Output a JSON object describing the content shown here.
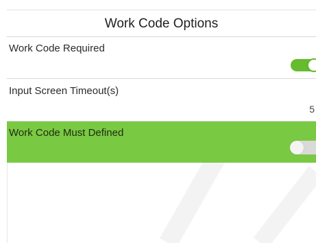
{
  "header": {
    "title": "Work Code Options"
  },
  "settings": [
    {
      "label": "Work Code Required",
      "control": "toggle",
      "state": "on"
    },
    {
      "label": "Input Screen Timeout(s)",
      "control": "value",
      "value": "5"
    },
    {
      "label": "Work Code Must Defined",
      "control": "toggle",
      "state": "off",
      "selected": true
    }
  ],
  "colors": {
    "selected_row": "#7ac943",
    "toggle_on": "#66bb2f",
    "toggle_off": "#d9d9d9"
  },
  "watermark": "ZKTeco"
}
